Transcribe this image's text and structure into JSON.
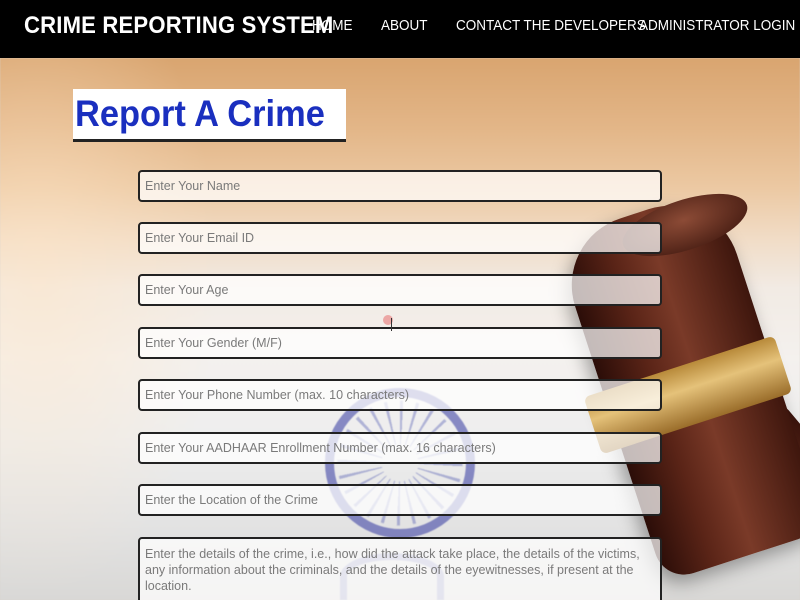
{
  "app": {
    "brand": "CRIME REPORTING SYSTEM"
  },
  "nav": {
    "items": [
      {
        "label": "HOME"
      },
      {
        "label": "ABOUT"
      },
      {
        "label": "CONTACT THE DEVELOPERS"
      },
      {
        "label": "ADMINISTRATOR LOGIN"
      }
    ]
  },
  "page": {
    "title": "Report A Crime"
  },
  "form": {
    "name": {
      "placeholder": "Enter Your Name",
      "value": ""
    },
    "email": {
      "placeholder": "Enter Your Email ID",
      "value": ""
    },
    "age": {
      "placeholder": "Enter Your Age",
      "value": ""
    },
    "gender": {
      "placeholder": "Enter Your Gender (M/F)",
      "value": ""
    },
    "phone": {
      "placeholder": "Enter Your Phone Number (max. 10 characters)",
      "value": ""
    },
    "aadhaar": {
      "placeholder": "Enter Your AADHAAR Enrollment Number (max. 16 characters)",
      "value": ""
    },
    "location": {
      "placeholder": "Enter the Location of the Crime",
      "value": ""
    },
    "details": {
      "placeholder": "Enter the details of the crime, i.e., how did the attack take place, the details of the victims, any information about the criminals, and the details of the eyewitnesses, if present at the location.",
      "value": ""
    }
  },
  "colors": {
    "navbar": "#000000",
    "heading_text": "#1a2fbf",
    "heading_bg": "#ffffff"
  }
}
